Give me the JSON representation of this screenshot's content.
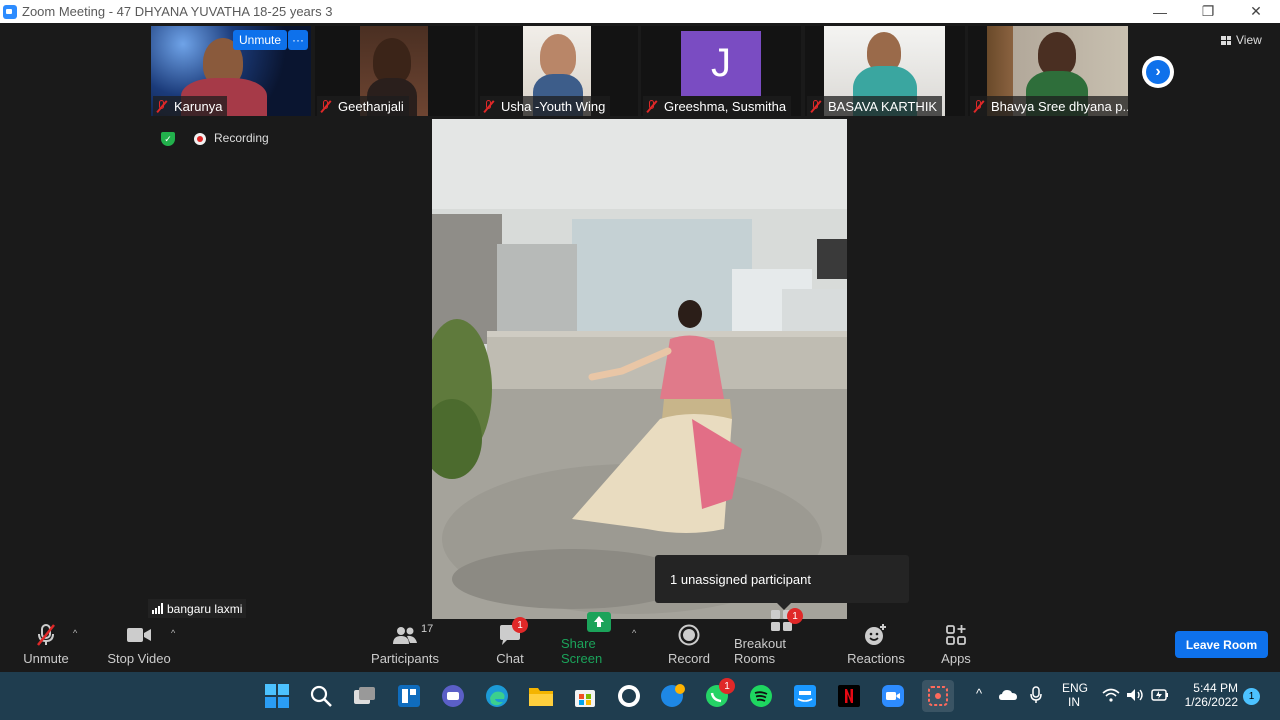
{
  "window": {
    "title": "Zoom Meeting - 47 DHYANA YUVATHA 18-25 years  3",
    "minimize": "—",
    "maximize": "❐",
    "close": "✕"
  },
  "strip": {
    "participants": [
      {
        "name": "Karunya",
        "unmute_label": "Unmute",
        "more_label": "···"
      },
      {
        "name": "Geethanjali"
      },
      {
        "name": "Usha -Youth Wing"
      },
      {
        "name": "Greeshma, Susmitha",
        "avatar_letter": "J"
      },
      {
        "name": "BASAVA KARTHIK"
      },
      {
        "name": "Bhavya Sree dhyana p..."
      }
    ],
    "view_label": "View",
    "next_glyph": "›"
  },
  "status": {
    "recording_label": "Recording",
    "shield_glyph": "✓"
  },
  "main": {
    "speaker_name": "bangaru laxmi"
  },
  "tooltip": {
    "text": "1 unassigned participant"
  },
  "toolbar": {
    "unmute_label": "Unmute",
    "stop_video_label": "Stop Video",
    "participants_label": "Participants",
    "participants_count": "17",
    "chat_label": "Chat",
    "chat_badge": "1",
    "share_label": "Share Screen",
    "record_label": "Record",
    "breakout_label": "Breakout Rooms",
    "breakout_badge": "1",
    "reactions_label": "Reactions",
    "apps_label": "Apps",
    "leave_label": "Leave Room",
    "caret_glyph": "^",
    "colors": {
      "share_green": "#1ba35a",
      "leave_blue": "#0e71eb",
      "badge_red": "#e02828"
    }
  },
  "taskbar": {
    "lang_top": "ENG",
    "lang_bottom": "IN",
    "time": "5:44 PM",
    "date": "1/26/2022",
    "notification_count": "1",
    "whatsapp_badge": "1",
    "tray_caret": "^",
    "apps": [
      "windows-start-icon",
      "search-icon",
      "task-view-icon",
      "widgets-icon",
      "teams-chat-icon",
      "edge-icon",
      "file-explorer-icon",
      "store-icon",
      "github-icon",
      "vscode-icon",
      "whatsapp-icon",
      "spotify-icon",
      "prime-video-icon",
      "netflix-icon",
      "zoom-icon",
      "snipping-tool-icon"
    ]
  }
}
